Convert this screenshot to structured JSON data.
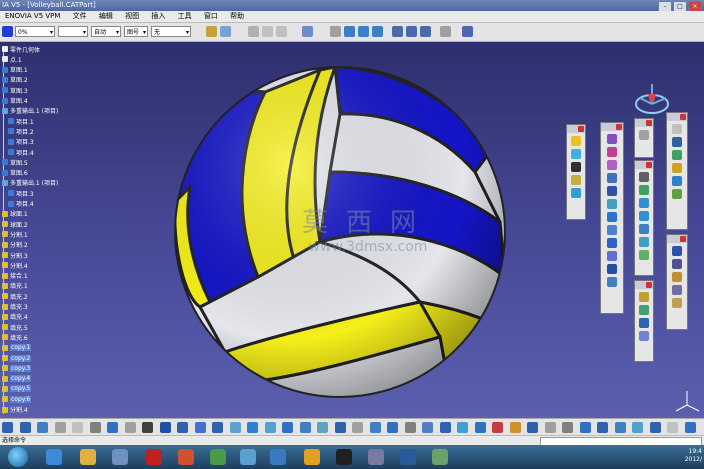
{
  "title": "IA V5 - [Volleyball.CATPart]",
  "menu": [
    "ENOVIA V5 VPM",
    "文件",
    "编辑",
    "视图",
    "插入",
    "工具",
    "窗口",
    "帮助"
  ],
  "toolbar": {
    "combo_percent": "0%",
    "combo_auto": "自动",
    "combo_layer": "图号",
    "combo_none": "无"
  },
  "tree": [
    {
      "label": "零件几何体",
      "hl": false,
      "color": "#f0f0f0"
    },
    {
      "label": "点.1",
      "hl": false,
      "color": "#e8e8e8"
    },
    {
      "label": "草图.1",
      "hl": false,
      "color": "#3b7bd6"
    },
    {
      "label": "草图.2",
      "hl": false,
      "color": "#3b7bd6"
    },
    {
      "label": "草图.3",
      "hl": false,
      "color": "#3b7bd6"
    },
    {
      "label": "草图.4",
      "hl": false,
      "color": "#3b7bd6"
    },
    {
      "label": "多重输出.1 (项目)",
      "hl": false,
      "color": "#5fa8e0"
    },
    {
      "label": "项目.1",
      "hl": false,
      "color": "#3b7bd6"
    },
    {
      "label": "项目.2",
      "hl": false,
      "color": "#3b7bd6"
    },
    {
      "label": "项目.3",
      "hl": false,
      "color": "#3b7bd6"
    },
    {
      "label": "项目.4",
      "hl": false,
      "color": "#3b7bd6"
    },
    {
      "label": "草图.5",
      "hl": false,
      "color": "#3b7bd6"
    },
    {
      "label": "草图.6",
      "hl": false,
      "color": "#3b7bd6"
    },
    {
      "label": "多重输出.1 (项目)",
      "hl": false,
      "color": "#5fa8e0"
    },
    {
      "label": "项目.3",
      "hl": false,
      "color": "#3b7bd6"
    },
    {
      "label": "项目.4",
      "hl": false,
      "color": "#3b7bd6"
    },
    {
      "label": "球面.1",
      "hl": false,
      "color": "#e0c030"
    },
    {
      "label": "球面.2",
      "hl": false,
      "color": "#e0c030"
    },
    {
      "label": "分割.1",
      "hl": false,
      "color": "#e0c030"
    },
    {
      "label": "分割.2",
      "hl": false,
      "color": "#e0c030"
    },
    {
      "label": "分割.3",
      "hl": false,
      "color": "#e0c030"
    },
    {
      "label": "分割.4",
      "hl": false,
      "color": "#e0c030"
    },
    {
      "label": "接合.1",
      "hl": false,
      "color": "#e0c030"
    },
    {
      "label": "填充.1",
      "hl": false,
      "color": "#e0c030"
    },
    {
      "label": "填充.2",
      "hl": false,
      "color": "#e0c030"
    },
    {
      "label": "填充.3",
      "hl": false,
      "color": "#e0c030"
    },
    {
      "label": "填充.4",
      "hl": false,
      "color": "#e0c030"
    },
    {
      "label": "填充.5",
      "hl": false,
      "color": "#e0c030"
    },
    {
      "label": "填充.6",
      "hl": false,
      "color": "#e0c030"
    },
    {
      "label": "copy.1",
      "hl": true,
      "color": "#e0c030"
    },
    {
      "label": "copy.2",
      "hl": true,
      "color": "#e0c030"
    },
    {
      "label": "copy.3",
      "hl": true,
      "color": "#e0c030"
    },
    {
      "label": "copy.4",
      "hl": true,
      "color": "#e0c030"
    },
    {
      "label": "copy.5",
      "hl": true,
      "color": "#e0c030"
    },
    {
      "label": "copy.6",
      "hl": true,
      "color": "#e0c030"
    },
    {
      "label": "分割.4",
      "hl": false,
      "color": "#e0c030"
    }
  ],
  "watermark": {
    "cn": "莫西网",
    "url": "www.3dmsx.com"
  },
  "status": {
    "text": "选择命令"
  },
  "clock": {
    "time": "19:4",
    "date": "2012/"
  },
  "colors": {
    "ball_yellow": "#f4ee1a",
    "ball_blue": "#1515c8",
    "ball_white": "#e4e6ec",
    "viewport_top": "#2e2f6e",
    "viewport_bottom": "#5a5fae"
  }
}
